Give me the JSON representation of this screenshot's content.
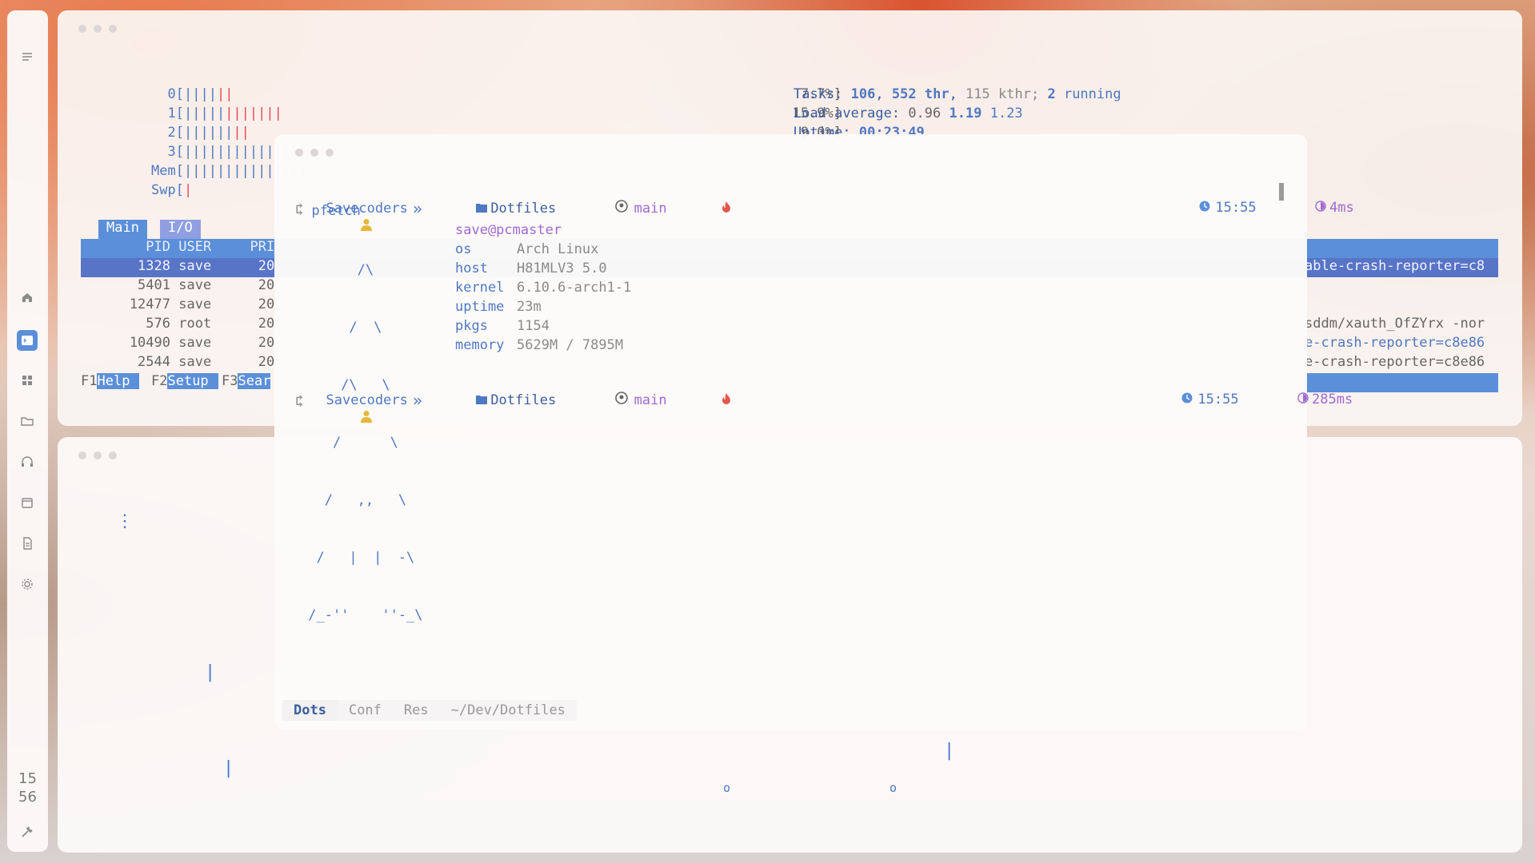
{
  "sidebar": {
    "clock_hour": "15",
    "clock_minute": "56"
  },
  "htop": {
    "cpu_lines": [
      {
        "label": "0[",
        "bars_blue": "||||",
        "bars_red": "||"
      },
      {
        "label": "1[",
        "bars_blue": "|||||",
        "bars_red": "|||||||"
      },
      {
        "label": "2[",
        "bars_blue": "||||||",
        "bars_red": "||"
      },
      {
        "label": "3[",
        "bars_blue": "|||||||||||||||",
        "bars_red": ""
      },
      {
        "label": "Mem[",
        "bars_blue": "|||||||||||||||",
        "bars_red": ""
      },
      {
        "label": "Swp[",
        "bars_blue": "",
        "bars_red": "|"
      }
    ],
    "right_pct": [
      "7.7%]",
      "15.9%]",
      "9.0%]"
    ],
    "tasks_line": {
      "label": "Tasks:",
      "tasks": "106",
      "thr": "552",
      "thr_label": "thr",
      "kthr": "115",
      "kthr_label": "kthr;",
      "running": "2",
      "running_label": "running"
    },
    "load_line": {
      "label": "Load average:",
      "v1": "0.96",
      "v2": "1.19",
      "v3": "1.23"
    },
    "uptime_line": {
      "label": "Uptime:",
      "value": "00:23:49"
    },
    "tabs": [
      "Main",
      "I/O"
    ],
    "columns": [
      "PID",
      "USER",
      "PRI"
    ],
    "rows": [
      {
        "pid": "1328",
        "user": "save",
        "pri": "20",
        "cmd": "able-crash-reporter=c8"
      },
      {
        "pid": "5401",
        "user": "save",
        "pri": "20",
        "cmd": ""
      },
      {
        "pid": "12477",
        "user": "save",
        "pri": "20",
        "cmd": ""
      },
      {
        "pid": "576",
        "user": "root",
        "pri": "20",
        "cmd": "sddm/xauth_OfZYrx -nor"
      },
      {
        "pid": "10490",
        "user": "save",
        "pri": "20",
        "cmd": "e-crash-reporter=c8e86"
      },
      {
        "pid": "2544",
        "user": "save",
        "pri": "20",
        "cmd": "e-crash-reporter=c8e86"
      }
    ],
    "fkeys": [
      {
        "key": "F1",
        "label": "Help"
      },
      {
        "key": "F2",
        "label": "Setup"
      },
      {
        "key": "F3",
        "label": "Sear"
      }
    ]
  },
  "lower_window": {
    "glyphs": [
      "⋮",
      "|",
      "|",
      "|",
      "o",
      "o"
    ]
  },
  "terminal": {
    "prompt1": {
      "user": "Savecoders",
      "sep": "»",
      "dir": "Dotfiles",
      "branch": "main",
      "time": "15:55",
      "duration": "4ms"
    },
    "command": "pfetch",
    "ascii_art": [
      "       /\\",
      "      /  \\",
      "     /\\   \\",
      "    /      \\",
      "   /   ,,   \\",
      "  /   |  |  -\\",
      " /_-''    ''-_\\"
    ],
    "fetch": {
      "title": "save@pcmaster",
      "rows": [
        {
          "key": "os",
          "value": "Arch Linux"
        },
        {
          "key": "host",
          "value": "H81MLV3 5.0"
        },
        {
          "key": "kernel",
          "value": "6.10.6-arch1-1"
        },
        {
          "key": "uptime",
          "value": "23m"
        },
        {
          "key": "pkgs",
          "value": "1154"
        },
        {
          "key": "memory",
          "value": "5629M / 7895M"
        }
      ]
    },
    "prompt2": {
      "user": "Savecoders",
      "sep": "»",
      "dir": "Dotfiles",
      "branch": "main",
      "time": "15:55",
      "duration": "285ms"
    },
    "statusbar": [
      "Dots",
      "Conf",
      "Res",
      "~/Dev/Dotfiles"
    ]
  },
  "colors": {
    "accent": "#5b8fd9",
    "user_yellow": "#e7b73a",
    "branch_purple": "#a06ad0",
    "flame_red": "#e2574c"
  }
}
